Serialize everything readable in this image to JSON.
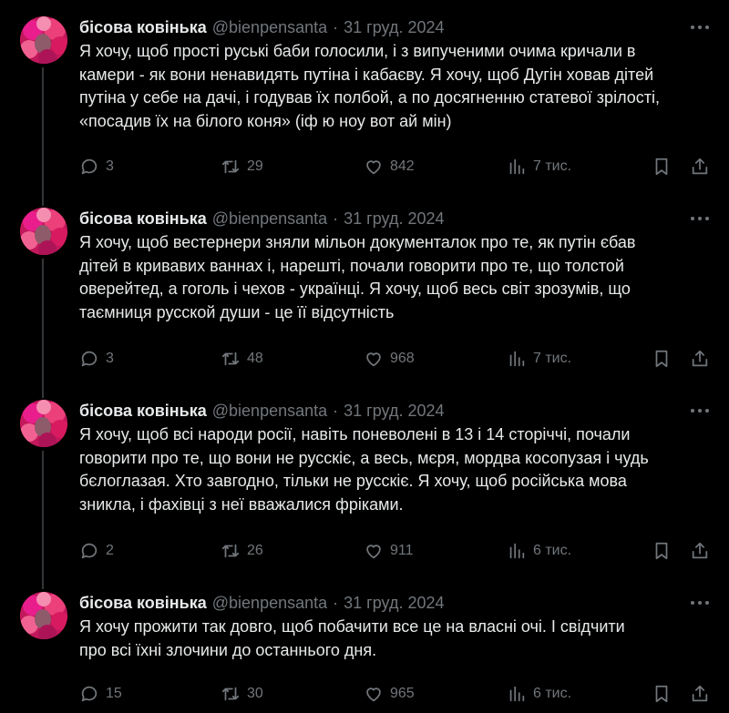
{
  "tweets": [
    {
      "author": {
        "name": "бісова ковінька",
        "handle": "@bienpensanta"
      },
      "date": "31 груд. 2024",
      "lines": [
        "Я хочу, щоб прості руські баби  голосили, і з випученими очима кричали в",
        "камери - як вони ненавидять путіна і кабаєву. Я хочу, щоб Дугін ховав дітей",
        "путіна у себе на дачі, і годував їх полбой, а по досягненню статевої зрілості,",
        "«посадив їх на білого коня» (іф ю ноу вот ай мін)"
      ],
      "stats": {
        "replies": "3",
        "reposts": "29",
        "likes": "842",
        "views": "7 тис."
      }
    },
    {
      "author": {
        "name": "бісова ковінька",
        "handle": "@bienpensanta"
      },
      "date": "31 груд. 2024",
      "lines": [
        "Я хочу, щоб вестернери зняли мільон документалок про те, як путін єбав",
        "дітей в кривавих ваннах і, нарешті, почали говорити про те, що толстой",
        "оверейтед, а гоголь і чехов - українці. Я хочу, щоб весь світ зрозумів, що",
        "таємниця русской души - це її відсутність"
      ],
      "stats": {
        "replies": "3",
        "reposts": "48",
        "likes": "968",
        "views": "7 тис."
      }
    },
    {
      "author": {
        "name": "бісова ковінька",
        "handle": "@bienpensanta"
      },
      "date": "31 груд. 2024",
      "lines": [
        "Я хочу, щоб всі народи росії, навіть поневолені в 13 і 14 сторіччі, почали",
        "говорити про те, що вони не русскіє, а весь, мєря, мордва косопузая і чудь",
        "бєлоглазая. Хто завгодно, тільки не русскіє. Я хочу, щоб російська мова",
        "зникла, і фахівці з неї вважалися фріками."
      ],
      "stats": {
        "replies": "2",
        "reposts": "26",
        "likes": "911",
        "views": "6 тис."
      }
    },
    {
      "author": {
        "name": "бісова ковінька",
        "handle": "@bienpensanta"
      },
      "date": "31 груд. 2024",
      "lines": [
        "Я хочу прожити так довго, щоб побачити все це на власні очі. І свідчити",
        "про всі їхні злочини до останнього дня."
      ],
      "stats": {
        "replies": "15",
        "reposts": "30",
        "likes": "965",
        "views": "6 тис."
      }
    }
  ],
  "colors": {
    "background": "#000000",
    "text": "#e7e9ea",
    "muted": "#71767b",
    "avatar": "#c2185b",
    "thread_line": "#333639"
  },
  "icons": [
    "reply-icon",
    "repost-icon",
    "like-icon",
    "views-icon",
    "bookmark-icon",
    "share-icon",
    "more-icon"
  ]
}
